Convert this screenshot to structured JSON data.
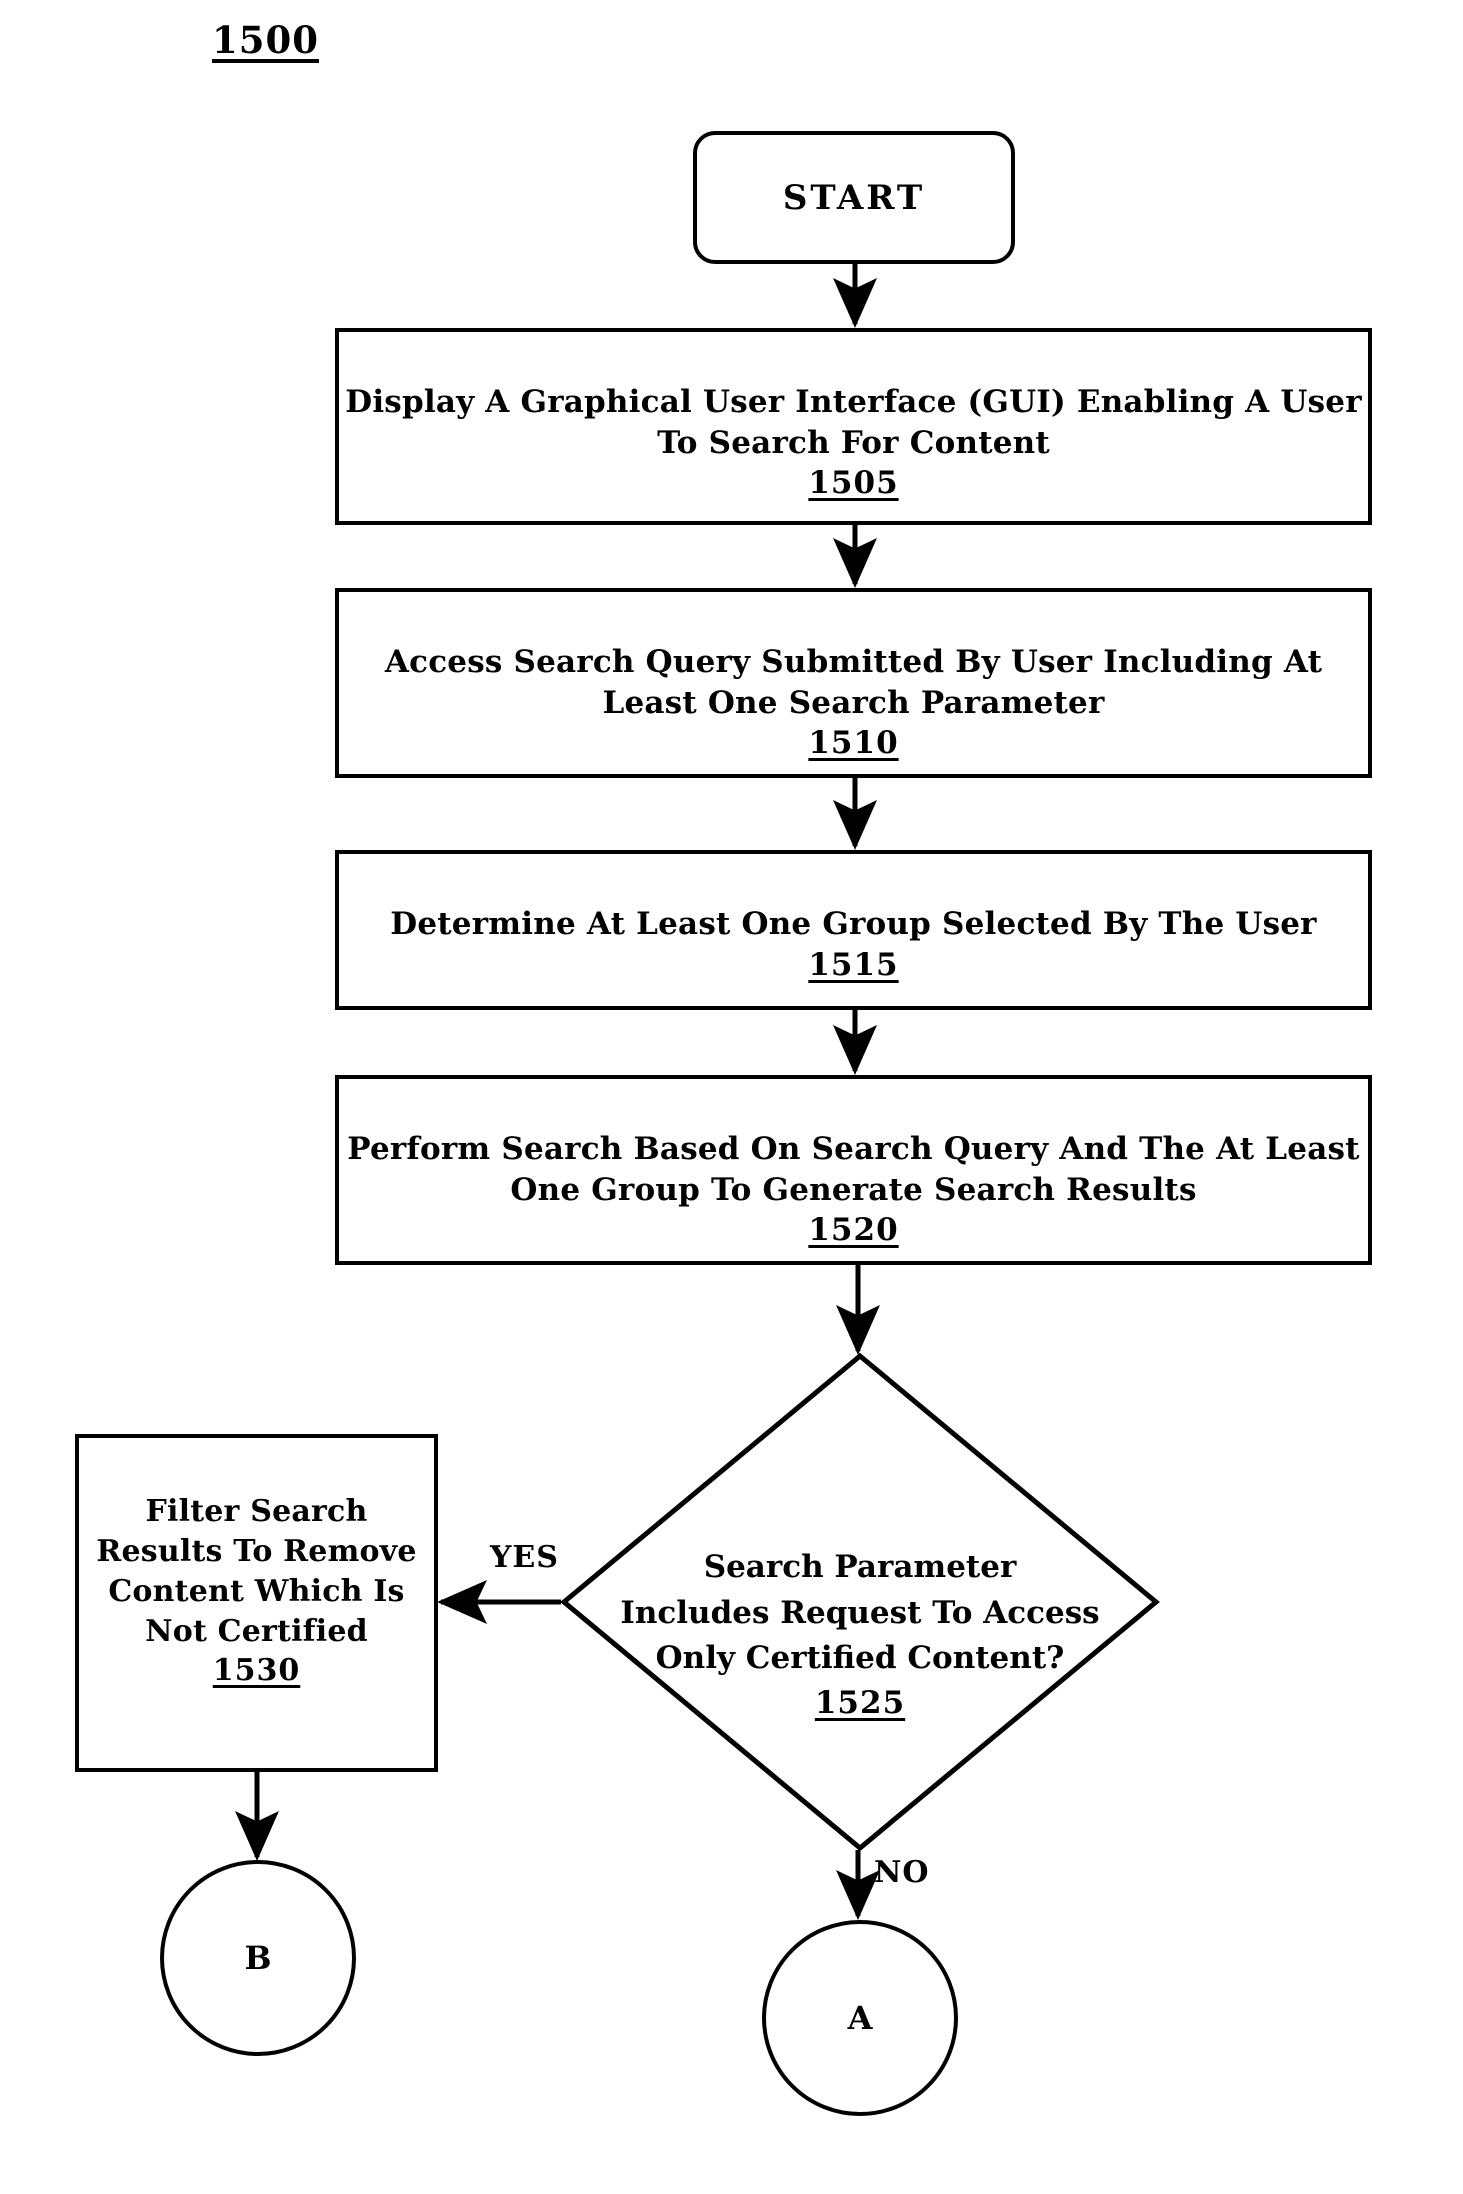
{
  "figure": {
    "number": "1500"
  },
  "nodes": {
    "start": {
      "label": "START"
    },
    "step_1505": {
      "text": "Display A Graphical User Interface (GUI) Enabling A User To Search For Content",
      "ref": "1505"
    },
    "step_1510": {
      "text": "Access Search Query Submitted By User Including At Least One Search Parameter",
      "ref": "1510"
    },
    "step_1515": {
      "text": "Determine At Least One Group Selected By The User",
      "ref": "1515"
    },
    "step_1520": {
      "text": "Perform Search Based On Search Query And The At Least One Group To Generate Search Results",
      "ref": "1520"
    },
    "decision_1525": {
      "text": "Search Parameter\nIncludes Request To Access\nOnly Certified Content?",
      "ref": "1525"
    },
    "step_1530": {
      "text": "Filter Search\nResults To Remove\nContent Which Is\nNot Certified",
      "ref": "1530"
    },
    "connector_b": {
      "label": "B"
    },
    "connector_a": {
      "label": "A"
    }
  },
  "branches": {
    "yes": "YES",
    "no": "NO"
  },
  "colors": {
    "stroke": "#000000",
    "background": "#ffffff",
    "text": "#000000"
  }
}
